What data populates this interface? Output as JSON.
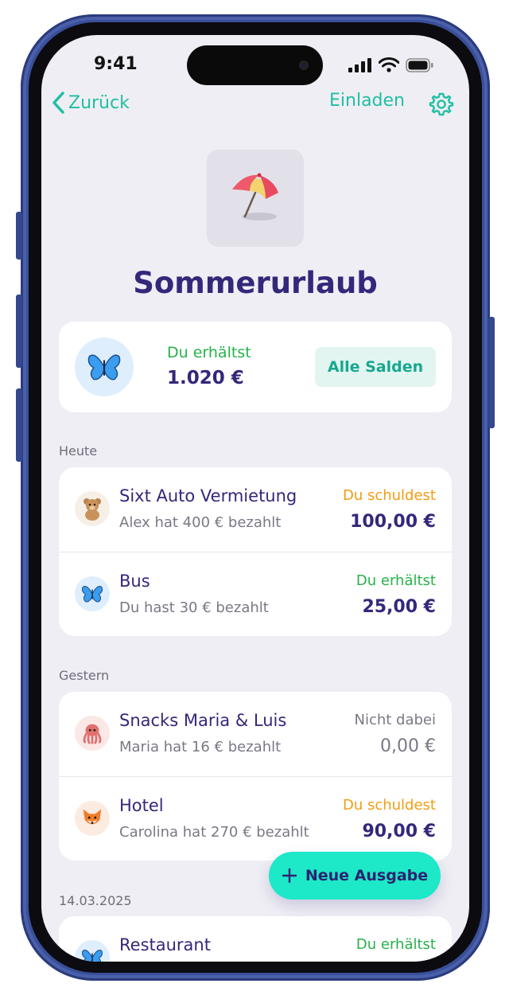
{
  "status_bar": {
    "time": "9:41"
  },
  "nav": {
    "back_label": "Zurück",
    "invite_label": "Einladen",
    "settings_icon": "gear-icon"
  },
  "group": {
    "icon": "umbrella-on-ground",
    "title": "Sommerurlaub"
  },
  "summary": {
    "avatar": "butterfly",
    "status": "Du erhältst",
    "amount": "1.020 €",
    "button_label": "Alle Salden"
  },
  "sections": [
    {
      "label": "Heute",
      "items": [
        {
          "title": "Sixt Auto Vermietung",
          "subtitle": "Alex hat 400 € bezahlt",
          "status": "Du schuldest",
          "amount": "100,00 €",
          "avatar": "teddy-bear"
        },
        {
          "title": "Bus",
          "subtitle": "Du hast 30 € bezahlt",
          "status": "Du erhältst",
          "amount": "25,00 €",
          "avatar": "butterfly"
        }
      ]
    },
    {
      "label": "Gestern",
      "items": [
        {
          "title": "Snacks Maria & Luis",
          "subtitle": "Maria hat 16 € bezahlt",
          "status": "Nicht dabei",
          "amount": "0,00 €",
          "avatar": "octopus"
        },
        {
          "title": "Hotel",
          "subtitle": "Carolina hat 270 € bezahlt",
          "status": "Du schuldest",
          "amount": "90,00 €",
          "avatar": "fox"
        }
      ]
    },
    {
      "label": "14.03.2025",
      "items": [
        {
          "title": "Restaurant",
          "status": "Du erhältst",
          "avatar": "butterfly"
        }
      ]
    }
  ],
  "fab": {
    "label": "Neue Ausgabe",
    "icon": "plus-icon"
  },
  "colors": {
    "accent": "#1fbfa2",
    "title": "#33287a",
    "receive": "#27b24a",
    "owe": "#f39c12",
    "neutral": "#7a7886",
    "fab": "#1de8c8",
    "background": "#efeef4"
  }
}
